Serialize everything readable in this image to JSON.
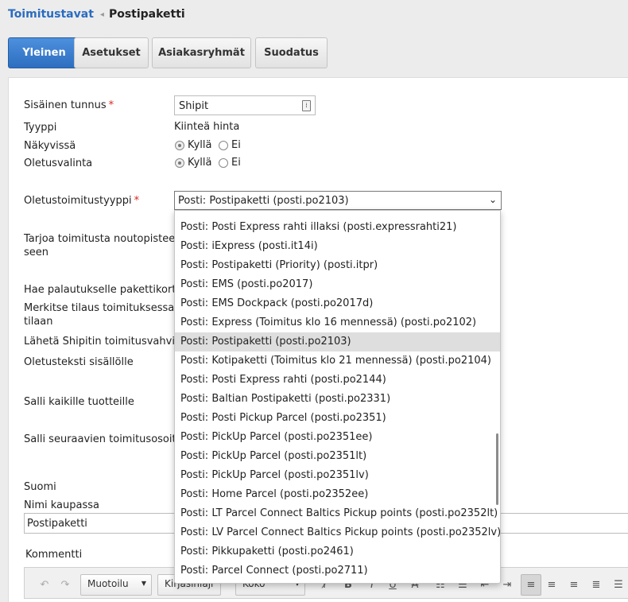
{
  "breadcrumb": {
    "parent": "Toimitustavat",
    "current": "Postipaketti"
  },
  "tabs": [
    "Yleinen",
    "Asetukset",
    "Asiakasryhmät",
    "Suodatus"
  ],
  "form": {
    "internal_id_label": "Sisäinen tunnus",
    "internal_id_value": "Shipit",
    "type_label": "Tyyppi",
    "type_value": "Kiinteä hinta",
    "visible_label": "Näkyvissä",
    "default_label": "Oletusvalinta",
    "yes": "Kyllä",
    "no": "Ei",
    "default_delivery_label": "Oletustoimitustyyppi",
    "default_delivery_value": "Posti: Postipaketti (posti.po2103)",
    "pickup_label_1": "Tarjoa toimitusta noutopistee-",
    "pickup_label_2": "seen",
    "return_label": "Hae palautukselle pakettikortti",
    "mark_label_1": "Merkitse tilaus toimituksessa-",
    "mark_label_2": "tilaan",
    "shipit_confirm_label": "Lähetä Shipitin toimitusvahvistus",
    "default_text_label": "Oletusteksti sisällölle",
    "allow_all_label": "Salli kaikille tuotteille",
    "allow_addresses_label": "Salli seuraavien toimitusosoitteiden",
    "language": "Suomi",
    "shop_name_label": "Nimi kaupassa",
    "shop_name_value": "Postipaketti",
    "comment_label": "Kommentti"
  },
  "toolbar": {
    "format": "Muotoilu",
    "font": "Kirjasinlaji",
    "size": "Koko"
  },
  "dropdown_options": [
    "Posti: Posti Express rahti illaksi (posti.expressrahti21)",
    "Posti: iExpress (posti.it14i)",
    "Posti: Postipaketti (Priority) (posti.itpr)",
    "Posti: EMS (posti.po2017)",
    "Posti: EMS Dockpack (posti.po2017d)",
    "Posti: Express (Toimitus klo 16 mennessä) (posti.po2102)",
    "Posti: Postipaketti (posti.po2103)",
    "Posti: Kotipaketti (Toimitus klo 21 mennessä) (posti.po2104)",
    "Posti: Posti Express rahti (posti.po2144)",
    "Posti: Baltian Postipaketti (posti.po2331)",
    "Posti: Posti Pickup Parcel (posti.po2351)",
    "Posti: PickUp Parcel (posti.po2351ee)",
    "Posti: PickUp Parcel (posti.po2351lt)",
    "Posti: PickUp Parcel (posti.po2351lv)",
    "Posti: Home Parcel (posti.po2352ee)",
    "Posti: LT Parcel Connect Baltics Pickup points (posti.po2352lt)",
    "Posti: LV Parcel Connect Baltics Pickup points (posti.po2352lv)",
    "Posti: Pikkupaketti (posti.po2461)",
    "Posti: Parcel Connect (posti.po2711)"
  ],
  "selected_option_index": 6,
  "colors": {
    "accent": "#2d6ec0",
    "link": "#2a6cc0",
    "required": "#d9251d"
  }
}
